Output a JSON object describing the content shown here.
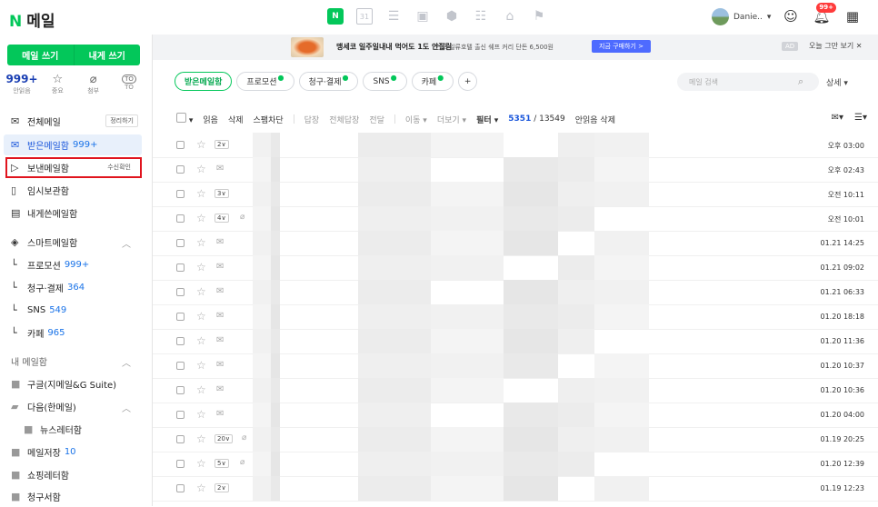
{
  "app": {
    "logo_n": "N",
    "logo_text": "메일"
  },
  "top_apps": [
    "mail-app-icon",
    "calendar-icon",
    "memo-icon",
    "contacts-icon",
    "cloud-icon",
    "todo-icon",
    "home-icon",
    "bookmark-icon"
  ],
  "mail_app_label": "N",
  "calendar_day": "31",
  "user": {
    "name": "Danie..",
    "notif_count": "99+"
  },
  "sidebar": {
    "compose": "메일 쓰기",
    "self_compose": "내게 쓰기",
    "quick": [
      {
        "value": "999+",
        "label": "안읽음"
      },
      {
        "icon": "☆",
        "label": "중요"
      },
      {
        "icon": "⌀",
        "label": "첨부"
      },
      {
        "icon": "TO",
        "label": "TO"
      }
    ],
    "items": [
      {
        "label": "전체메일",
        "side": "정리하기"
      },
      {
        "label": "받은메일함",
        "count": "999+"
      },
      {
        "label": "보낸메일함",
        "side": "수신확인"
      },
      {
        "label": "임시보관함"
      },
      {
        "label": "내게쓴메일함"
      },
      {
        "label": "스마트메일함"
      },
      {
        "label": "프로모션",
        "count": "999+"
      },
      {
        "label": "청구·결제",
        "count": "364"
      },
      {
        "label": "SNS",
        "count": "549"
      },
      {
        "label": "카페",
        "count": "965"
      },
      {
        "label": "내 메일함"
      },
      {
        "label": "구글(지메일&G Suite)"
      },
      {
        "label": "다음(한메일)"
      },
      {
        "label": "뉴스레터함"
      },
      {
        "label": "메일저장",
        "count": "10"
      },
      {
        "label": "쇼핑레터함"
      },
      {
        "label": "청구서함"
      }
    ]
  },
  "ad": {
    "title": "맹세코 일주일내내 먹어도 1도 안질림",
    "sub": "인도 일류호텔 출신 쉐프 커리 단돈 6,500원",
    "cta": "지금 구매하기 >",
    "tag": "AD",
    "close": "오늘 그만 보기 ✕"
  },
  "tabs": [
    "받은메일함",
    "프로모션",
    "청구·결제",
    "SNS",
    "카페",
    "+"
  ],
  "search": {
    "placeholder": "메일 검색",
    "detail": "상세 ▾"
  },
  "toolbar": {
    "read": "읽음",
    "delete": "삭제",
    "spam": "스팸차단",
    "reply": "답장",
    "reply_all": "전체답장",
    "forward": "전달",
    "move": "이동 ▾",
    "more": "더보기 ▾",
    "filter": "필터 ▾",
    "unread": "5351",
    "total": " / 13549",
    "unread_delete": "안읽음 삭제"
  },
  "colors": {
    "accent": "#03c75a",
    "link": "#1a56db",
    "highlight": "#e0141e"
  },
  "mails": [
    {
      "time": "오후 03:00",
      "badge": "2"
    },
    {
      "time": "오후 02:43"
    },
    {
      "time": "오전 10:11",
      "badge": "3"
    },
    {
      "time": "오전 10:01",
      "badge": "4",
      "clip": true
    },
    {
      "time": "01.21 14:25"
    },
    {
      "time": "01.21 09:02"
    },
    {
      "time": "01.21 06:33"
    },
    {
      "time": "01.20 18:18"
    },
    {
      "time": "01.20 11:36"
    },
    {
      "time": "01.20 10:37"
    },
    {
      "time": "01.20 10:36"
    },
    {
      "time": "01.20 04:00"
    },
    {
      "time": "01.19 20:25"
    },
    {
      "time": "01.20 12:39",
      "badge": "5",
      "clip": true
    },
    {
      "time": "01.19 12:23",
      "badge": "2"
    }
  ],
  "mail_badge_ext": {
    "12": {
      "badge": "20",
      "clip": true
    }
  }
}
